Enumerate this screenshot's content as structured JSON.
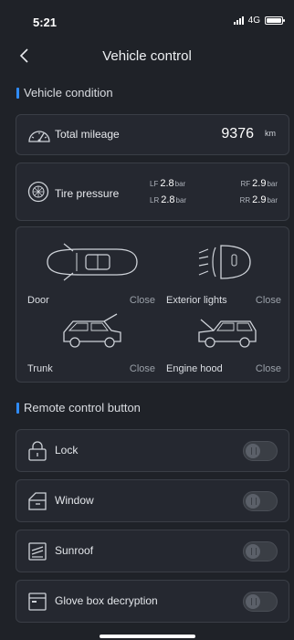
{
  "status_bar": {
    "time": "5:21",
    "network": "4G"
  },
  "nav": {
    "title": "Vehicle control"
  },
  "sections": {
    "condition": "Vehicle condition",
    "remote": "Remote control button"
  },
  "mileage": {
    "label": "Total mileage",
    "value": "9376",
    "unit": "km"
  },
  "tire_pressure": {
    "label": "Tire pressure",
    "lf": {
      "pos": "LF",
      "value": "2.8",
      "unit": "bar"
    },
    "rf": {
      "pos": "RF",
      "value": "2.9",
      "unit": "bar"
    },
    "lr": {
      "pos": "LR",
      "value": "2.8",
      "unit": "bar"
    },
    "rr": {
      "pos": "RR",
      "value": "2.9",
      "unit": "bar"
    }
  },
  "status_items": [
    {
      "label": "Door",
      "value": "Close",
      "icon": "car-top-door-icon"
    },
    {
      "label": "Exterior lights",
      "value": "Close",
      "icon": "headlight-icon"
    },
    {
      "label": "Trunk",
      "value": "Close",
      "icon": "suv-trunk-icon"
    },
    {
      "label": "Engine hood",
      "value": "Close",
      "icon": "suv-hood-icon"
    }
  ],
  "controls": [
    {
      "label": "Lock",
      "icon": "lock-icon",
      "on": false
    },
    {
      "label": "Window",
      "icon": "window-icon",
      "on": false
    },
    {
      "label": "Sunroof",
      "icon": "sunroof-icon",
      "on": false
    },
    {
      "label": "Glove box decryption",
      "icon": "glovebox-icon",
      "on": false
    }
  ],
  "colors": {
    "accent": "#2f8cff",
    "background": "#1f2228",
    "card": "#252830"
  }
}
